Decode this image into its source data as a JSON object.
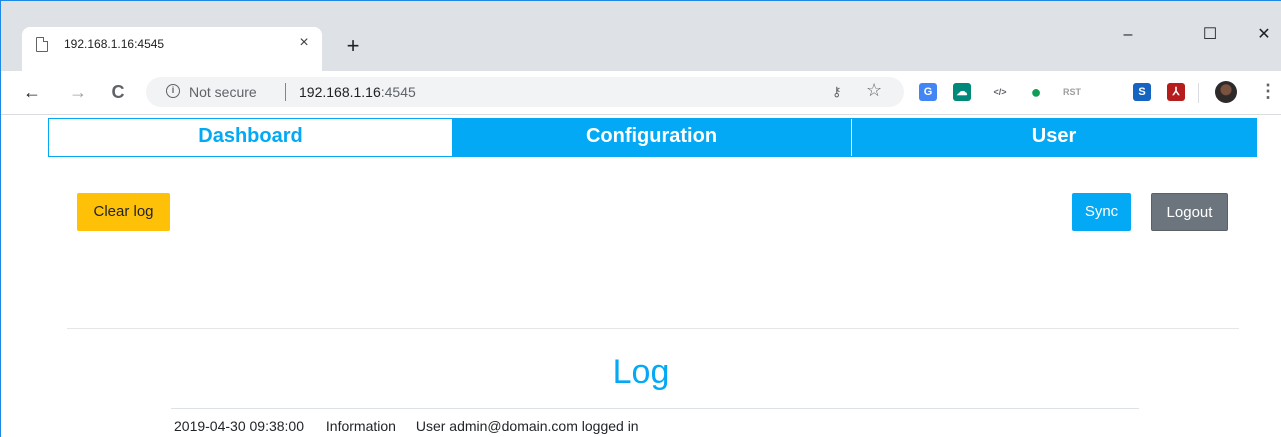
{
  "browser": {
    "tab_title": "192.168.1.16:4545",
    "tab_close": "×",
    "new_tab": "+",
    "minimize": "–",
    "maximize": "☐",
    "close": "✕",
    "back": "←",
    "forward": "→",
    "reload": "C",
    "security_text": "Not secure",
    "url_host": "192.168.1.16",
    "url_port": ":4545",
    "extensions": [
      {
        "name": "google-translate-icon",
        "color": "#4285f4",
        "glyph": "G"
      },
      {
        "name": "cloud-icon",
        "color": "#00897b",
        "glyph": "☁"
      },
      {
        "name": "code-icon",
        "color": "#5f6368",
        "glyph": "</>"
      },
      {
        "name": "hangouts-icon",
        "color": "#0f9d58",
        "glyph": "●"
      },
      {
        "name": "rst-icon",
        "color": "#9e9e9e",
        "glyph": "RST"
      },
      {
        "name": "s-extension-icon",
        "color": "#1565c0",
        "glyph": "S"
      },
      {
        "name": "pdf-icon",
        "color": "#b71c1c",
        "glyph": "⅄"
      }
    ]
  },
  "nav": {
    "dashboard": "Dashboard",
    "configuration": "Configuration",
    "user": "User"
  },
  "actions": {
    "clear_log": "Clear log",
    "sync": "Sync",
    "logout": "Logout"
  },
  "log": {
    "title": "Log",
    "entries": [
      {
        "timestamp": "2019-04-30 09:38:00",
        "level": "Information",
        "message": "User admin@domain.com logged in"
      }
    ]
  },
  "colors": {
    "accent": "#03a9f4",
    "warning": "#ffc107",
    "secondary": "#6c757d"
  }
}
